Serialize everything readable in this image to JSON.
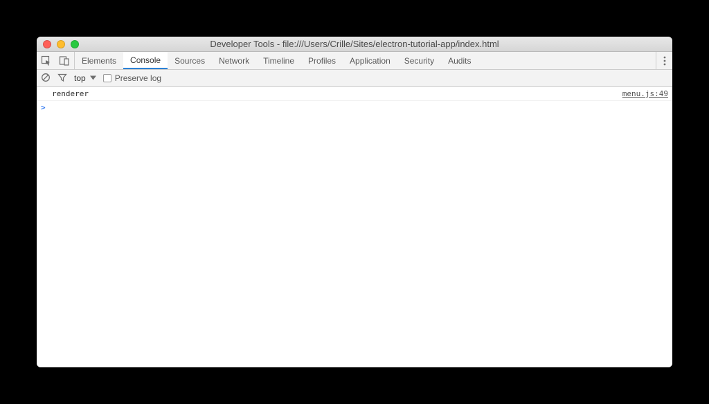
{
  "titlebar": {
    "title": "Developer Tools - file:///Users/Crille/Sites/electron-tutorial-app/index.html"
  },
  "tabs": {
    "items": [
      {
        "label": "Elements"
      },
      {
        "label": "Console"
      },
      {
        "label": "Sources"
      },
      {
        "label": "Network"
      },
      {
        "label": "Timeline"
      },
      {
        "label": "Profiles"
      },
      {
        "label": "Application"
      },
      {
        "label": "Security"
      },
      {
        "label": "Audits"
      }
    ],
    "activeIndex": 1
  },
  "consoleToolbar": {
    "context": "top",
    "preserveLogLabel": "Preserve log",
    "preserveLogChecked": false
  },
  "console": {
    "rows": [
      {
        "message": "renderer",
        "source": "menu.js:49"
      }
    ],
    "promptSymbol": ">"
  }
}
